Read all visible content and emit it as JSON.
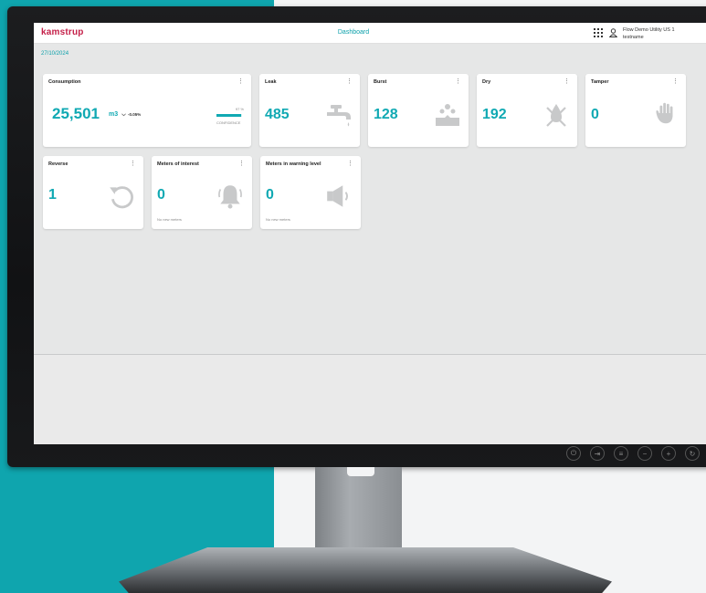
{
  "app": {
    "logo": "kamstrup",
    "title": "Dashboard",
    "user_line1": "Flow Demo Utility US 1",
    "user_line2": "testname",
    "date": "27/10/2024"
  },
  "cards": {
    "consumption": {
      "title": "Consumption",
      "value": "25,501",
      "unit": "m3",
      "change": "-0.05%",
      "confidence_pct": "97 %",
      "confidence_label": "CONFIDENCE",
      "confidence_value": 0.97
    },
    "leak": {
      "title": "Leak",
      "value": "485"
    },
    "burst": {
      "title": "Burst",
      "value": "128"
    },
    "dry": {
      "title": "Dry",
      "value": "192"
    },
    "tamper": {
      "title": "Tamper",
      "value": "0"
    },
    "reverse": {
      "title": "Reverse",
      "value": "1"
    },
    "interest": {
      "title": "Meters of interest",
      "value": "0",
      "note": "No new meters"
    },
    "warning": {
      "title": "Meters in warning level",
      "value": "0",
      "note": "No new meters"
    }
  },
  "menu_glyph": "⋮",
  "colors": {
    "accent": "#10a9b3",
    "brand_red": "#c41f48",
    "teal_background": "#0fa5ae"
  }
}
